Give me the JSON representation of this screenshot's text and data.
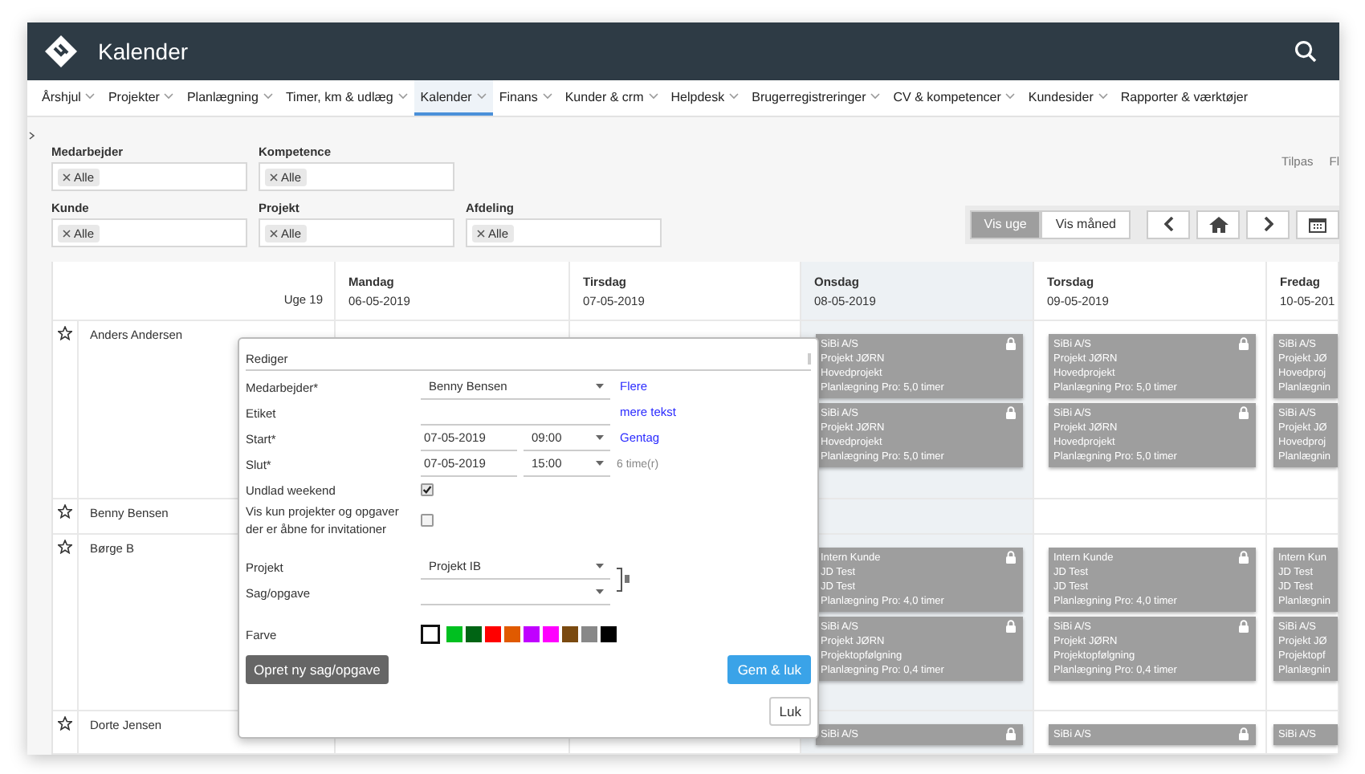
{
  "header": {
    "title": "Kalender"
  },
  "nav": [
    {
      "label": "Årshjul",
      "selected": false
    },
    {
      "label": "Projekter",
      "selected": false
    },
    {
      "label": "Planlægning",
      "selected": false
    },
    {
      "label": "Timer, km & udlæg",
      "selected": false
    },
    {
      "label": "Kalender",
      "selected": true
    },
    {
      "label": "Finans",
      "selected": false
    },
    {
      "label": "Kunder & crm",
      "selected": false
    },
    {
      "label": "Helpdesk",
      "selected": false
    },
    {
      "label": "Brugerregistreringer",
      "selected": false
    },
    {
      "label": "CV & kompetencer",
      "selected": false
    },
    {
      "label": "Kundesider",
      "selected": false
    },
    {
      "label": "Rapporter & værktøjer",
      "selected": false
    }
  ],
  "filters": [
    [
      {
        "label": "Medarbejder",
        "tags": [
          "Alle"
        ]
      },
      {
        "label": "Kompetence",
        "tags": [
          "Alle"
        ]
      }
    ],
    [
      {
        "label": "Kunde",
        "tags": [
          "Alle"
        ]
      },
      {
        "label": "Projekt",
        "tags": [
          "Alle"
        ]
      },
      {
        "label": "Afdeling",
        "tags": [
          "Alle"
        ]
      }
    ]
  ],
  "side_links": [
    "Tilpas",
    "Fl"
  ],
  "view_toggle": [
    {
      "label": "Vis uge",
      "selected": true
    },
    {
      "label": "Vis måned",
      "selected": false
    }
  ],
  "calendar": {
    "week": "Uge 19",
    "days": [
      {
        "name": "Mandag",
        "date": "06-05-2019",
        "highlighted": false
      },
      {
        "name": "Tirsdag",
        "date": "07-05-2019",
        "highlighted": false
      },
      {
        "name": "Onsdag",
        "date": "08-05-2019",
        "highlighted": true
      },
      {
        "name": "Torsdag",
        "date": "09-05-2019",
        "highlighted": false
      },
      {
        "name": "Fredag",
        "date": "10-05-201",
        "highlighted": false
      }
    ],
    "rows": [
      {
        "name": "Anders Andersen",
        "starred": false,
        "day_3": [
          {
            "lines": [
              "SiBi A/S",
              "Projekt JØRN",
              "Hovedprojekt",
              "Planlægning Pro: 5,0 timer"
            ],
            "locked": true
          },
          {
            "lines": [
              "SiBi A/S",
              "Projekt JØRN",
              "Hovedprojekt",
              "Planlægning Pro: 5,0 timer"
            ],
            "locked": true
          }
        ],
        "day_4": [
          {
            "lines": [
              "SiBi A/S",
              "Projekt JØRN",
              "Hovedprojekt",
              "Planlægning Pro: 5,0 timer"
            ],
            "locked": true
          },
          {
            "lines": [
              "SiBi A/S",
              "Projekt JØRN",
              "Hovedprojekt",
              "Planlægning Pro: 5,0 timer"
            ],
            "locked": true
          }
        ],
        "day_5": [
          {
            "lines": [
              "SiBi A/S",
              "Projekt JØ",
              "Hovedproj",
              "Planlægnin"
            ],
            "locked": false
          },
          {
            "lines": [
              "SiBi A/S",
              "Projekt JØ",
              "Hovedproj",
              "Planlægnin"
            ],
            "locked": false
          }
        ]
      },
      {
        "name": "Benny Bensen",
        "starred": false
      },
      {
        "name": "Børge B",
        "starred": false,
        "day_3": [
          {
            "lines": [
              "Intern Kunde",
              "JD Test",
              "JD Test",
              "Planlægning Pro: 4,0 timer"
            ],
            "locked": true
          },
          {
            "lines": [
              "SiBi A/S",
              "Projekt JØRN",
              "Projektopfølgning",
              "Planlægning Pro: 0,4 timer"
            ],
            "locked": true
          }
        ],
        "day_4": [
          {
            "lines": [
              "Intern Kunde",
              "JD Test",
              "JD Test",
              "Planlægning Pro: 4,0 timer"
            ],
            "locked": true
          },
          {
            "lines": [
              "SiBi A/S",
              "Projekt JØRN",
              "Projektopfølgning",
              "Planlægning Pro: 0,4 timer"
            ],
            "locked": true
          }
        ],
        "day_5": [
          {
            "lines": [
              "Intern Kun",
              "JD Test",
              "JD Test",
              "Planlægnin"
            ],
            "locked": false
          },
          {
            "lines": [
              "SiBi A/S",
              "Projekt JØ",
              "Projektopf",
              "Planlægnin"
            ],
            "locked": false
          }
        ]
      },
      {
        "name": "Dorte Jensen",
        "starred": false,
        "day_3": [
          {
            "lines": [
              "SiBi A/S"
            ],
            "locked": true
          }
        ],
        "day_4": [
          {
            "lines": [
              "SiBi A/S"
            ],
            "locked": true
          }
        ],
        "day_5": [
          {
            "lines": [
              "SiBi A/S"
            ],
            "locked": false
          }
        ]
      }
    ]
  },
  "editor": {
    "title": "Rediger",
    "fields": [
      {
        "kind": "select",
        "label": "Medarbejder*",
        "value": "Benny Bensen",
        "link": "Flere"
      },
      {
        "kind": "text",
        "label": "Etiket",
        "link": "mere tekst"
      },
      {
        "kind": "datetime",
        "label": "Start*",
        "date": "07-05-2019",
        "time": "09:00",
        "link": "Gentag"
      },
      {
        "kind": "datetime",
        "label": "Slut*",
        "date": "07-05-2019",
        "time": "15:00",
        "note": "6 time(r)"
      },
      {
        "kind": "checkbox",
        "label": "Undlad weekend",
        "checked": true
      },
      {
        "kind": "checkbox",
        "label": "Vis kun projekter og opgaver der er åbne for invitationer",
        "checked": false
      }
    ],
    "project_fields": [
      {
        "label": "Projekt",
        "value": "Projekt IB"
      },
      {
        "label": "Sag/opgave"
      }
    ],
    "color_label": "Farve",
    "colors": [
      {
        "color": "#ffffff",
        "selected": true
      },
      {
        "color": "#00c020",
        "selected": false
      },
      {
        "color": "#006414",
        "selected": false
      },
      {
        "color": "#ff0000",
        "selected": false
      },
      {
        "color": "#e05a00",
        "selected": false
      },
      {
        "color": "#c000ff",
        "selected": false
      },
      {
        "color": "#ff00ff",
        "selected": false
      },
      {
        "color": "#7a4a10",
        "selected": false
      },
      {
        "color": "#888888",
        "selected": false
      },
      {
        "color": "#000000",
        "selected": false
      }
    ],
    "create_button": "Opret ny sag/opgave",
    "save_button": "Gem & luk",
    "close_button": "Luk"
  }
}
